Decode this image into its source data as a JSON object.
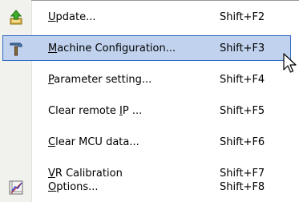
{
  "menu": {
    "items": [
      {
        "pre": "",
        "mnemonic": "U",
        "post": "pdate...",
        "shortcut": "Shift+F2",
        "icon": "update-arrow-icon",
        "highlighted": false
      },
      {
        "pre": "",
        "mnemonic": "M",
        "post": "achine Configuration...",
        "shortcut": "Shift+F3",
        "icon": "hammer-icon",
        "highlighted": true
      },
      {
        "pre": "",
        "mnemonic": "P",
        "post": "arameter setting...",
        "shortcut": "Shift+F4",
        "icon": "",
        "highlighted": false
      },
      {
        "pre": "Clear remote ",
        "mnemonic": "I",
        "post": "P ...",
        "shortcut": "Shift+F5",
        "icon": "",
        "highlighted": false
      },
      {
        "pre": "",
        "mnemonic": "C",
        "post": "lear MCU data...",
        "shortcut": "Shift+F6",
        "icon": "",
        "highlighted": false
      },
      {
        "pre": "",
        "mnemonic": "V",
        "post": "R Calibration",
        "shortcut": "Shift+F7",
        "icon": "",
        "highlighted": false
      },
      {
        "pre": "",
        "mnemonic": "O",
        "post": "ptions...",
        "shortcut": "Shift+F8",
        "icon": "options-chart-icon",
        "highlighted": false
      }
    ]
  },
  "colors": {
    "highlight_fill": "#c1d2ee",
    "highlight_border": "#316ac5",
    "icon_strip": "#f1f1ee"
  }
}
